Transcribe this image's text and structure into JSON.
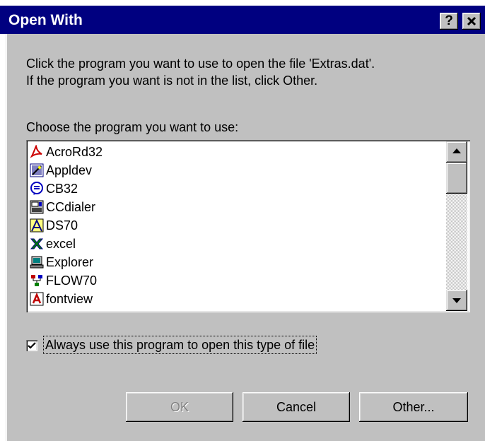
{
  "window": {
    "title": "Open With",
    "help_label": "?",
    "close_label": "✕"
  },
  "instructions": {
    "line1": "Click the program you want to use to open the file 'Extras.dat'.",
    "line2": "If the program you want is not in the list, click Other."
  },
  "list": {
    "label": "Choose the program you want to use:",
    "items": [
      {
        "label": "AcroRd32",
        "icon": "acrobat-reader-icon"
      },
      {
        "label": "Appldev",
        "icon": "appldev-icon"
      },
      {
        "label": "CB32",
        "icon": "cb32-icon"
      },
      {
        "label": "CCdialer",
        "icon": "ccdialer-icon"
      },
      {
        "label": "DS70",
        "icon": "ds70-icon"
      },
      {
        "label": "excel",
        "icon": "excel-icon"
      },
      {
        "label": "Explorer",
        "icon": "explorer-icon"
      },
      {
        "label": "FLOW70",
        "icon": "flow70-icon"
      },
      {
        "label": "fontview",
        "icon": "fontview-icon"
      }
    ]
  },
  "always_use": {
    "label": "Always use this program to open this type of file",
    "checked": true
  },
  "buttons": {
    "ok": "OK",
    "cancel": "Cancel",
    "other": "Other..."
  }
}
